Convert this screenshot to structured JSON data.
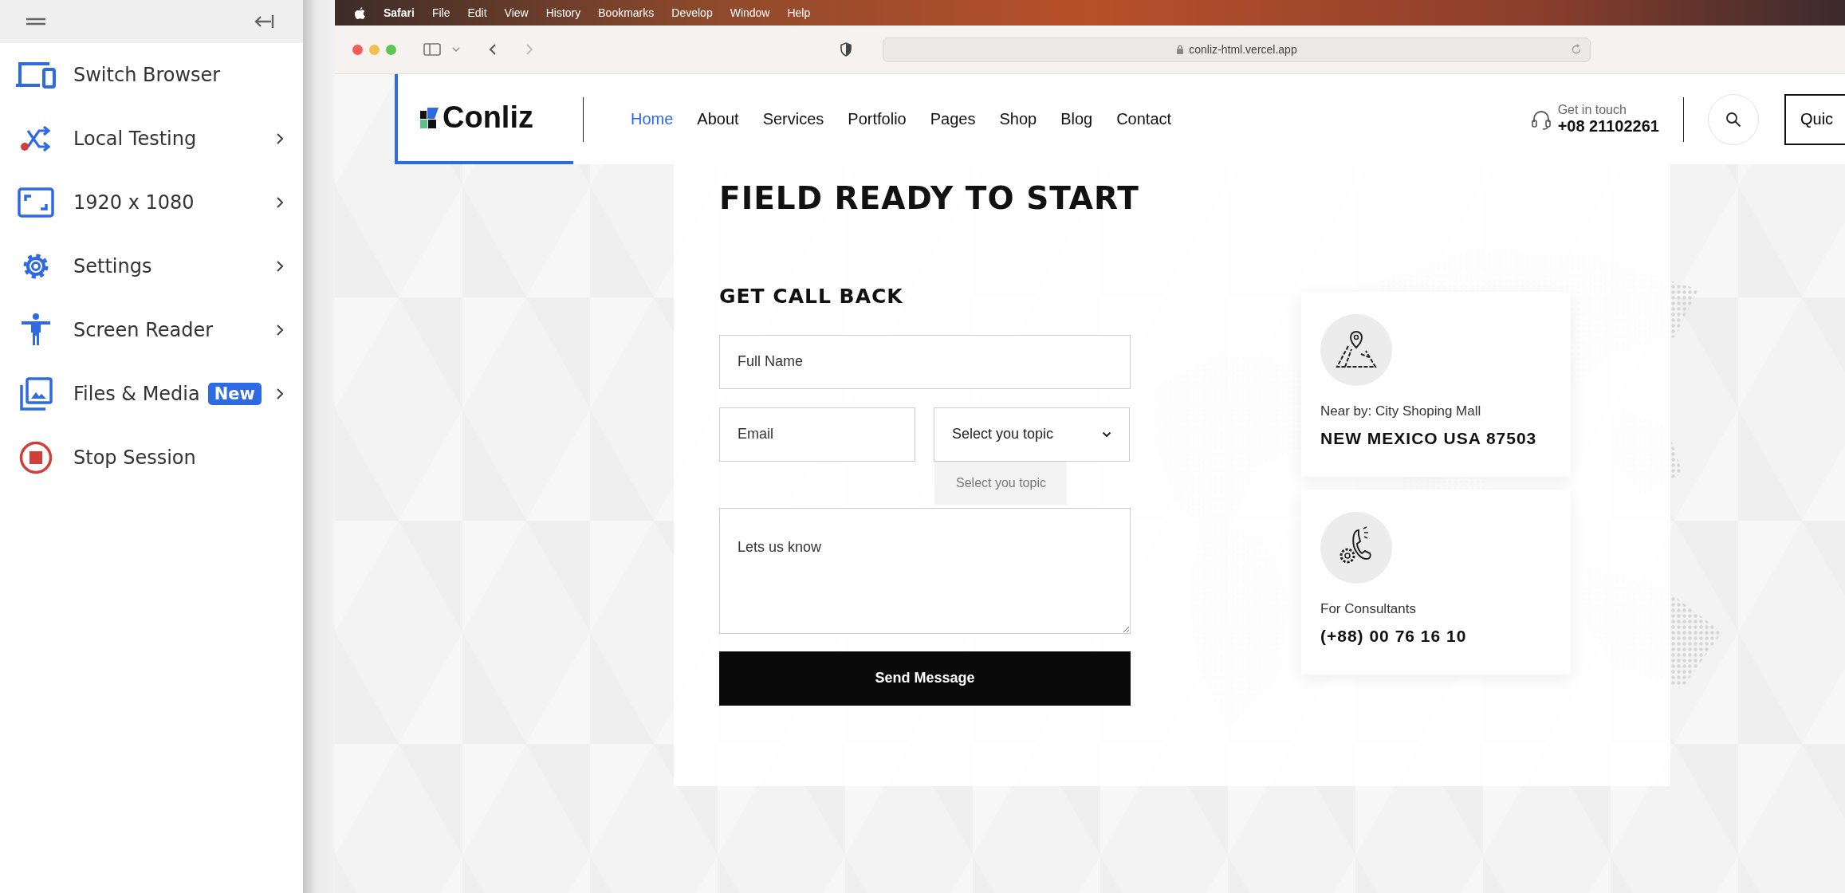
{
  "sidebar": {
    "items": [
      {
        "label": "Switch Browser",
        "has_submenu": false
      },
      {
        "label": "Local Testing",
        "has_submenu": true
      },
      {
        "label": "1920 x 1080",
        "has_submenu": true
      },
      {
        "label": "Settings",
        "has_submenu": true
      },
      {
        "label": "Screen Reader",
        "has_submenu": true
      },
      {
        "label": "Files & Media",
        "has_submenu": true,
        "badge": "New"
      },
      {
        "label": "Stop Session",
        "has_submenu": false
      }
    ]
  },
  "menu_bar": {
    "app": "Safari",
    "items": [
      "File",
      "Edit",
      "View",
      "History",
      "Bookmarks",
      "Develop",
      "Window",
      "Help"
    ]
  },
  "address_bar": {
    "url": "conliz-html.vercel.app"
  },
  "site_nav": {
    "logo": "Conliz",
    "links": [
      {
        "label": "Home",
        "selected": true
      },
      {
        "label": "About",
        "selected": false
      },
      {
        "label": "Services",
        "selected": false
      },
      {
        "label": "Portfolio",
        "selected": false
      },
      {
        "label": "Pages",
        "selected": false
      },
      {
        "label": "Shop",
        "selected": false
      },
      {
        "label": "Blog",
        "selected": false
      },
      {
        "label": "Contact",
        "selected": false
      }
    ],
    "contact_label": "Get in touch",
    "contact_phone": "+08 21102261",
    "cta_button": "Quic"
  },
  "heading": "FIELD READY TO START",
  "form": {
    "title": "GET CALL BACK",
    "name_placeholder": "Full Name",
    "email_placeholder": "Email",
    "topic_value": "Select you topic",
    "topic_option": "Select you topic",
    "message_placeholder": "Lets us know",
    "submit": "Send Message"
  },
  "info_cards": [
    {
      "label": "Near by: City Shoping Mall",
      "value": "NEW MEXICO USA 87503"
    },
    {
      "label": "For Consultants",
      "value": "(+88) 00 76 16 10"
    }
  ]
}
